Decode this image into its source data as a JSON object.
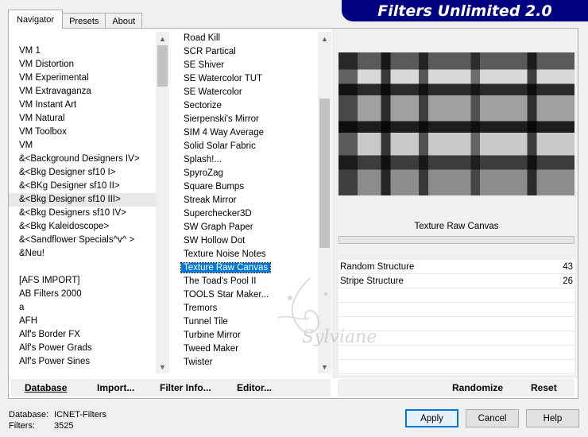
{
  "banner": {
    "title": "Filters Unlimited 2.0"
  },
  "tabs": [
    {
      "label": "Navigator",
      "active": true
    },
    {
      "label": "Presets",
      "active": false
    },
    {
      "label": "About",
      "active": false
    }
  ],
  "categories": {
    "items": [
      "VM 1",
      "VM Distortion",
      "VM Experimental",
      "VM Extravaganza",
      "VM Instant Art",
      "VM Natural",
      "VM Toolbox",
      "VM",
      "&<Background Designers IV>",
      "&<Bkg Designer sf10 I>",
      "&<BKg Designer sf10 II>",
      "&<Bkg Designer sf10 III>",
      "&<Bkg Designers sf10 IV>",
      "&<Bkg Kaleidoscope>",
      "&<Sandflower Specials^v^ >",
      "&Neu!",
      "",
      "[AFS IMPORT]",
      "AB Filters 2000",
      "a",
      "AFH",
      "Alf's Border FX",
      "Alf's Power Grads",
      "Alf's Power Sines"
    ],
    "selected_index": 11
  },
  "filters": {
    "items": [
      "Road Kill",
      "SCR  Partical",
      "SE Shiver",
      "SE Watercolor TUT",
      "SE Watercolor",
      "Sectorize",
      "Sierpenski's Mirror",
      "SIM 4 Way Average",
      "Solid Solar Fabric",
      "Splash!...",
      "SpyroZag",
      "Square Bumps",
      "Streak Mirror",
      "Superchecker3D",
      "SW Graph Paper",
      "SW Hollow Dot",
      "Texture Noise Notes",
      "Texture Raw Canvas",
      "The Toad's Pool II",
      "TOOLS Star Maker...",
      "Tremors",
      "Tunnel Tile",
      "Turbine Mirror",
      "Tweed Maker",
      "Twister"
    ],
    "selected_index": 17
  },
  "preview": {
    "filter_name": "Texture Raw Canvas",
    "progress": 0
  },
  "params": [
    {
      "name": "Random Structure",
      "value": "43"
    },
    {
      "name": "Stripe Structure",
      "value": "26"
    }
  ],
  "toolbar": {
    "database": "Database",
    "import": "Import...",
    "filter_info": "Filter Info...",
    "editor": "Editor...",
    "randomize": "Randomize",
    "reset": "Reset"
  },
  "footer": {
    "database_label": "Database:",
    "database_value": "ICNET-Filters",
    "filters_label": "Filters:",
    "filters_value": "3525",
    "apply": "Apply",
    "cancel": "Cancel",
    "help": "Help"
  },
  "watermark": {
    "text": "Sylviane"
  },
  "colors": {
    "banner": "#000080",
    "selection": "#0078d7"
  }
}
